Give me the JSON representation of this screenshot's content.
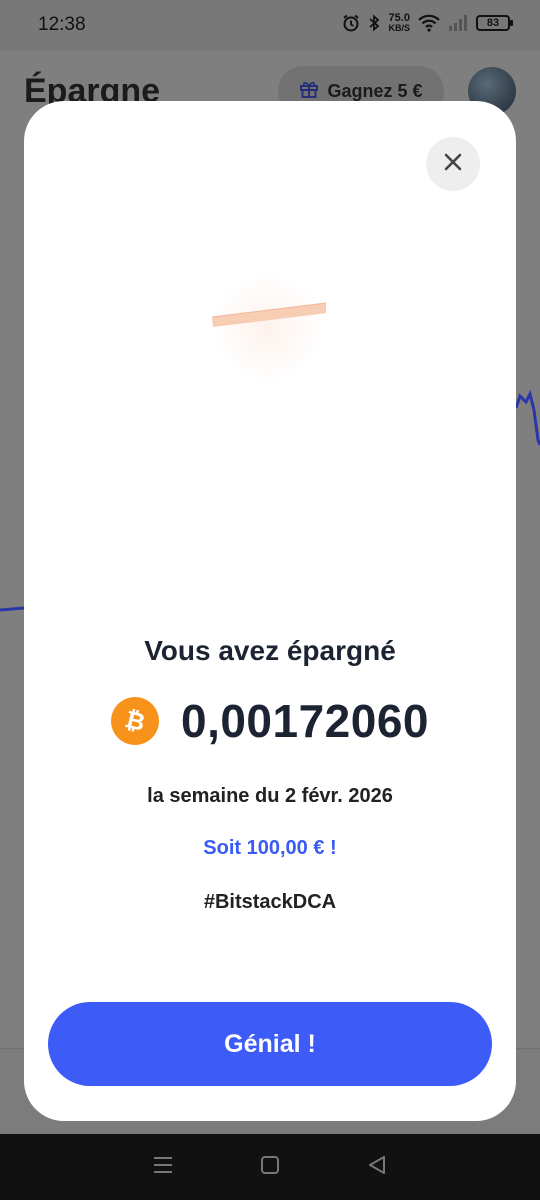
{
  "status_bar": {
    "time": "12:38",
    "net_speed_value": "75.0",
    "net_speed_unit": "KB/S",
    "battery": "83"
  },
  "background": {
    "title": "Épargne",
    "gift_label": "Gagnez 5 €"
  },
  "modal": {
    "headline": "Vous avez épargné",
    "amount": "0,00172060",
    "currency_icon": "bitcoin-icon",
    "week": "la semaine du 2 févr. 2026",
    "equivalent": "Soit 100,00 € !",
    "hashtag": "#BitstackDCA",
    "cta_label": "Génial !"
  },
  "colors": {
    "accent": "#3d5bf6",
    "bitcoin": "#f7931a",
    "text_dark": "#1c2433"
  }
}
